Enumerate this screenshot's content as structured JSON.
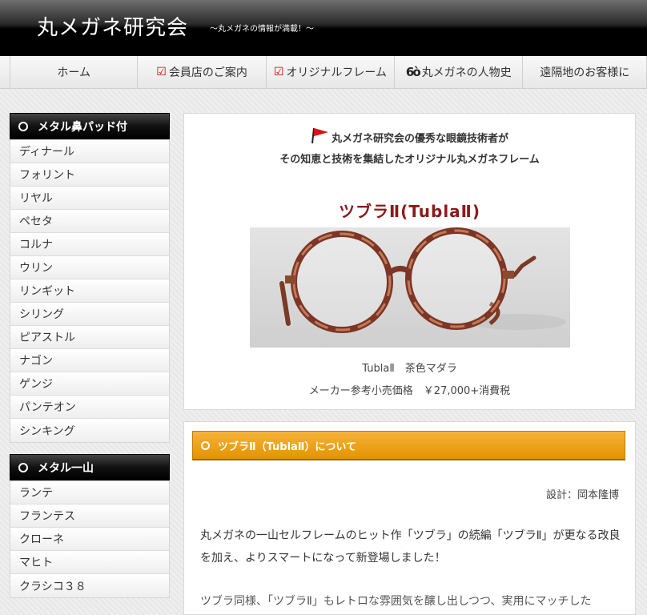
{
  "header": {
    "title": "丸メガネ研究会",
    "tagline": "〜丸メガネの情報が満載！〜"
  },
  "nav": {
    "items": [
      {
        "label": "ホーム",
        "icon": ""
      },
      {
        "label": "会員店のご案内",
        "icon": "check-icon"
      },
      {
        "label": "オリジナルフレーム",
        "icon": "check-icon"
      },
      {
        "label": "丸メガネの人物史",
        "icon": "glasses-icon",
        "icon_glyph": "6ò"
      },
      {
        "label": "遠隔地のお客様に",
        "icon": ""
      }
    ]
  },
  "sidebar": {
    "sections": [
      {
        "title": "メタル鼻パッド付",
        "items": [
          "ディナール",
          "フォリント",
          "リヤル",
          "ペセタ",
          "コルナ",
          "ウリン",
          "リンギット",
          "シリング",
          "ピアストル",
          "ナゴン",
          "ゲンジ",
          "パンテオン",
          "シンキング"
        ]
      },
      {
        "title": "メタル一山",
        "items": [
          "ランテ",
          "フランテス",
          "クローネ",
          "マヒト",
          "クラシコ３８"
        ]
      }
    ]
  },
  "product": {
    "intro_line1": "丸メガネ研究会の優秀な眼鏡技術者が",
    "intro_line2": "その知恵と技術を集結したオリジナル丸メガネフレーム",
    "name": "ツブラⅡ(TublaⅡ)",
    "caption_model": "TublaⅡ　茶色マダラ",
    "caption_price": "メーカー参考小売価格　￥27,000+消費税"
  },
  "section": {
    "title": "ツブラⅡ（TublaⅡ）について",
    "designer": "設計：岡本隆博",
    "paragraph1": "丸メガネの一山セルフレームのヒット作「ツブラ」の続編「ツブラⅡ」が更なる改良を加え、よりスマートになって新登場しました！",
    "paragraph2": "ツブラ同様、「ツブラⅡ」もレトロな雰囲気を醸し出しつつ、実用にマッチした"
  },
  "colors": {
    "header_bg": "#000000",
    "accent_orange": "#e39400",
    "product_name": "#8b1a1a",
    "check_red": "#cc0000"
  }
}
